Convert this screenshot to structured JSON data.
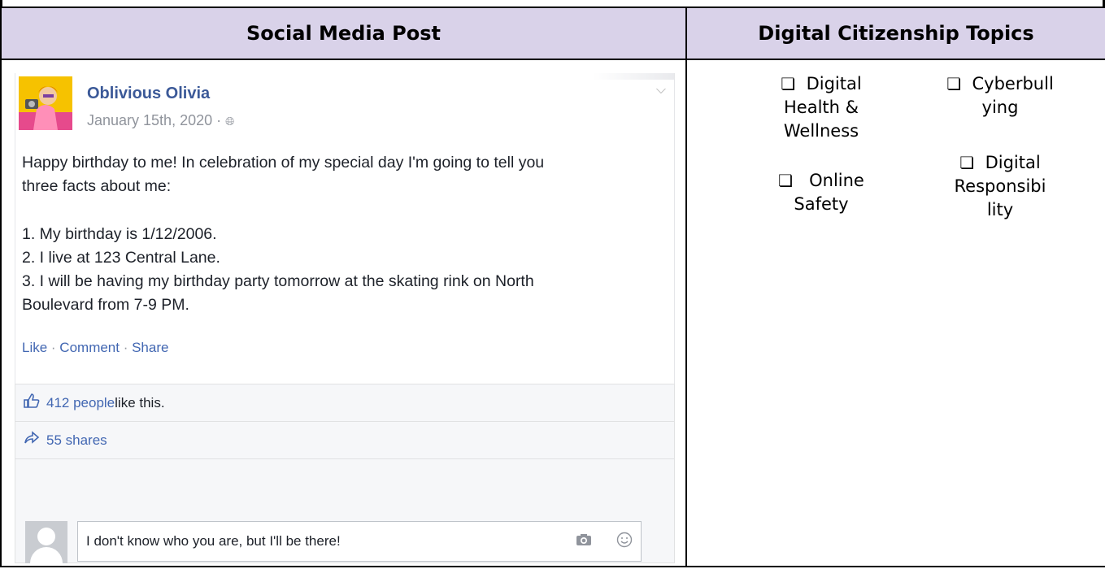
{
  "headers": {
    "left": "Social Media Post",
    "right": "Digital Citizenship Topics"
  },
  "post": {
    "author": "Oblivious Olivia",
    "date": "January 15th, 2020 ·",
    "body_intro_1": "Happy birthday to me! In celebration of my special day I'm going to tell you",
    "body_intro_2": "three facts about me:",
    "fact_1": "1. My birthday is 1/12/2006.",
    "fact_2": "2. I live at 123 Central Lane.",
    "fact_3_line1": "3. I will be having my birthday party tomorrow at the skating rink on North",
    "fact_3_line2": "Boulevard from 7-9 PM.",
    "actions": {
      "like": "Like",
      "comment": "Comment",
      "share": "Share",
      "separator": " · "
    },
    "likes_count": "412 people",
    "likes_suffix": " like this.",
    "shares": "55 shares",
    "comment_text": "I don't know who you are, but I'll be there!"
  },
  "topics": {
    "digital_health": {
      "box": "❏",
      "line1": "Digital",
      "line2": "Health &",
      "line3": "Wellness"
    },
    "online_safety": {
      "box": "❏",
      "line1": "Online",
      "line2": "Safety"
    },
    "cyberbullying": {
      "box": "❏",
      "line1": "Cyberbull",
      "line2": "ying"
    },
    "digital_responsibility": {
      "box": "❏",
      "line1": "Digital",
      "line2": "Responsibi",
      "line3": "lity"
    }
  },
  "colors": {
    "header_bg": "#d9d2e9",
    "fb_blue": "#3b5998",
    "link_blue": "#4267b2",
    "avatar_bg": "#f6c200"
  },
  "icons": [
    "globe-icon",
    "chevron-down-icon",
    "thumbs-up-icon",
    "share-arrow-icon",
    "camera-icon",
    "smiley-icon",
    "checkbox-icon"
  ]
}
